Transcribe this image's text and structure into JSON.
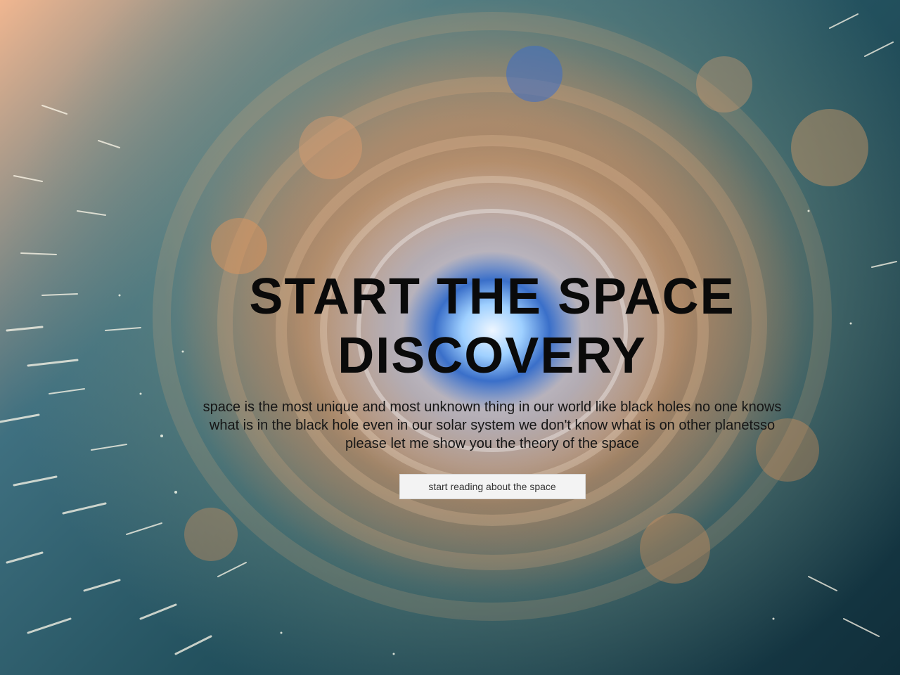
{
  "hero": {
    "title": "START THE SPACE DISCOVERY",
    "description": "space is the most unique and most unknown thing in our world like black holes no one knows what is in the black hole even in our solar system we don't know what is on other planetsso please let me show you the theory of the space",
    "button_label": "start reading about the space"
  },
  "colors": {
    "title_text": "#0a0a0a",
    "button_background": "#f3f3f3",
    "portal_core": "#3a6fc9",
    "nebula_warm": "#f0b690",
    "nebula_cool": "#23515e"
  }
}
